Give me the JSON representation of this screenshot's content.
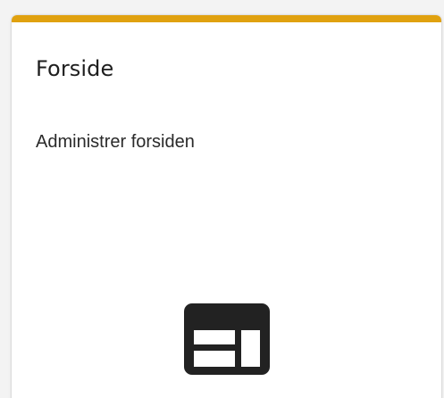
{
  "card": {
    "title": "Forside",
    "description": "Administrer forsiden",
    "icon": "web-layout-icon",
    "accent_color": "#e0a10f"
  }
}
